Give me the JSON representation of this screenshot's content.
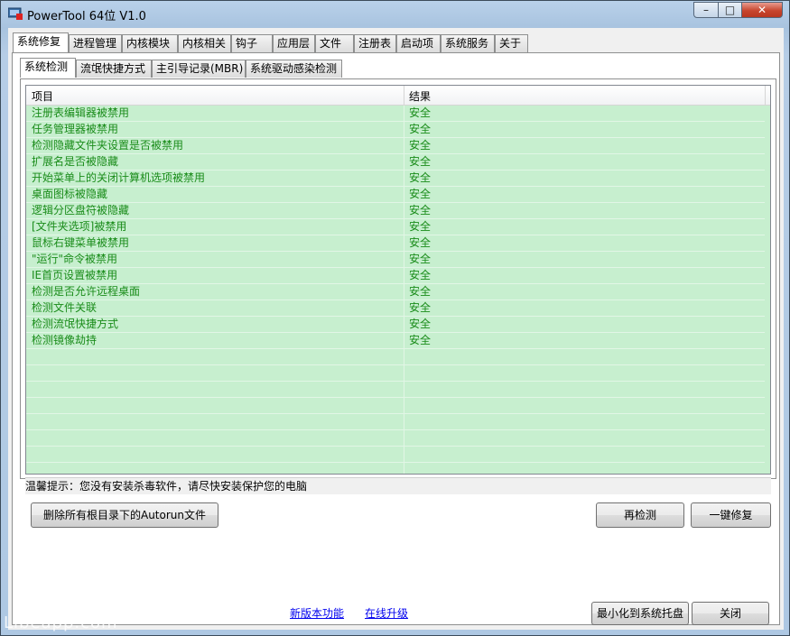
{
  "window": {
    "title": "PowerTool 64位 V1.0",
    "controls": {
      "minimize": "–",
      "maximize": "□",
      "close": "✕"
    }
  },
  "main_tabs": [
    "系统修复",
    "进程管理",
    "内核模块",
    "内核相关",
    "钩子",
    "应用层",
    "文件",
    "注册表",
    "启动项",
    "系统服务",
    "关于"
  ],
  "sub_tabs": [
    "系统检测",
    "流氓快捷方式",
    "主引导记录(MBR)",
    "系统驱动感染检测"
  ],
  "list": {
    "headers": {
      "item": "项目",
      "result": "结果"
    },
    "rows": [
      {
        "item": "注册表编辑器被禁用",
        "result": "安全"
      },
      {
        "item": "任务管理器被禁用",
        "result": "安全"
      },
      {
        "item": "检测隐藏文件夹设置是否被禁用",
        "result": "安全"
      },
      {
        "item": "扩展名是否被隐藏",
        "result": "安全"
      },
      {
        "item": "开始菜单上的关闭计算机选项被禁用",
        "result": "安全"
      },
      {
        "item": "桌面图标被隐藏",
        "result": "安全"
      },
      {
        "item": "逻辑分区盘符被隐藏",
        "result": "安全"
      },
      {
        "item": "[文件夹选项]被禁用",
        "result": "安全"
      },
      {
        "item": "鼠标右键菜单被禁用",
        "result": "安全"
      },
      {
        "item": "\"运行\"命令被禁用",
        "result": "安全"
      },
      {
        "item": "IE首页设置被禁用",
        "result": "安全"
      },
      {
        "item": "检测是否允许远程桌面",
        "result": "安全"
      },
      {
        "item": "检测文件关联",
        "result": "安全"
      },
      {
        "item": "检测流氓快捷方式",
        "result": "安全"
      },
      {
        "item": "检测镜像劫持",
        "result": "安全"
      }
    ]
  },
  "tip": "温馨提示：您没有安装杀毒软件，请尽快安装保护您的电脑",
  "buttons": {
    "delete_autorun": "删除所有根目录下的Autorun文件",
    "recheck": "再检测",
    "one_click_repair": "一键修复",
    "minimize_to_tray": "最小化到系统托盘",
    "close": "关闭"
  },
  "links": {
    "new_features": "新版本功能",
    "online_upgrade": "在线升级"
  },
  "watermark": "Libeapp.com",
  "colors": {
    "list_bg": "#c7efcf",
    "row_text": "#1a8c1a",
    "link": "#0000ee"
  }
}
